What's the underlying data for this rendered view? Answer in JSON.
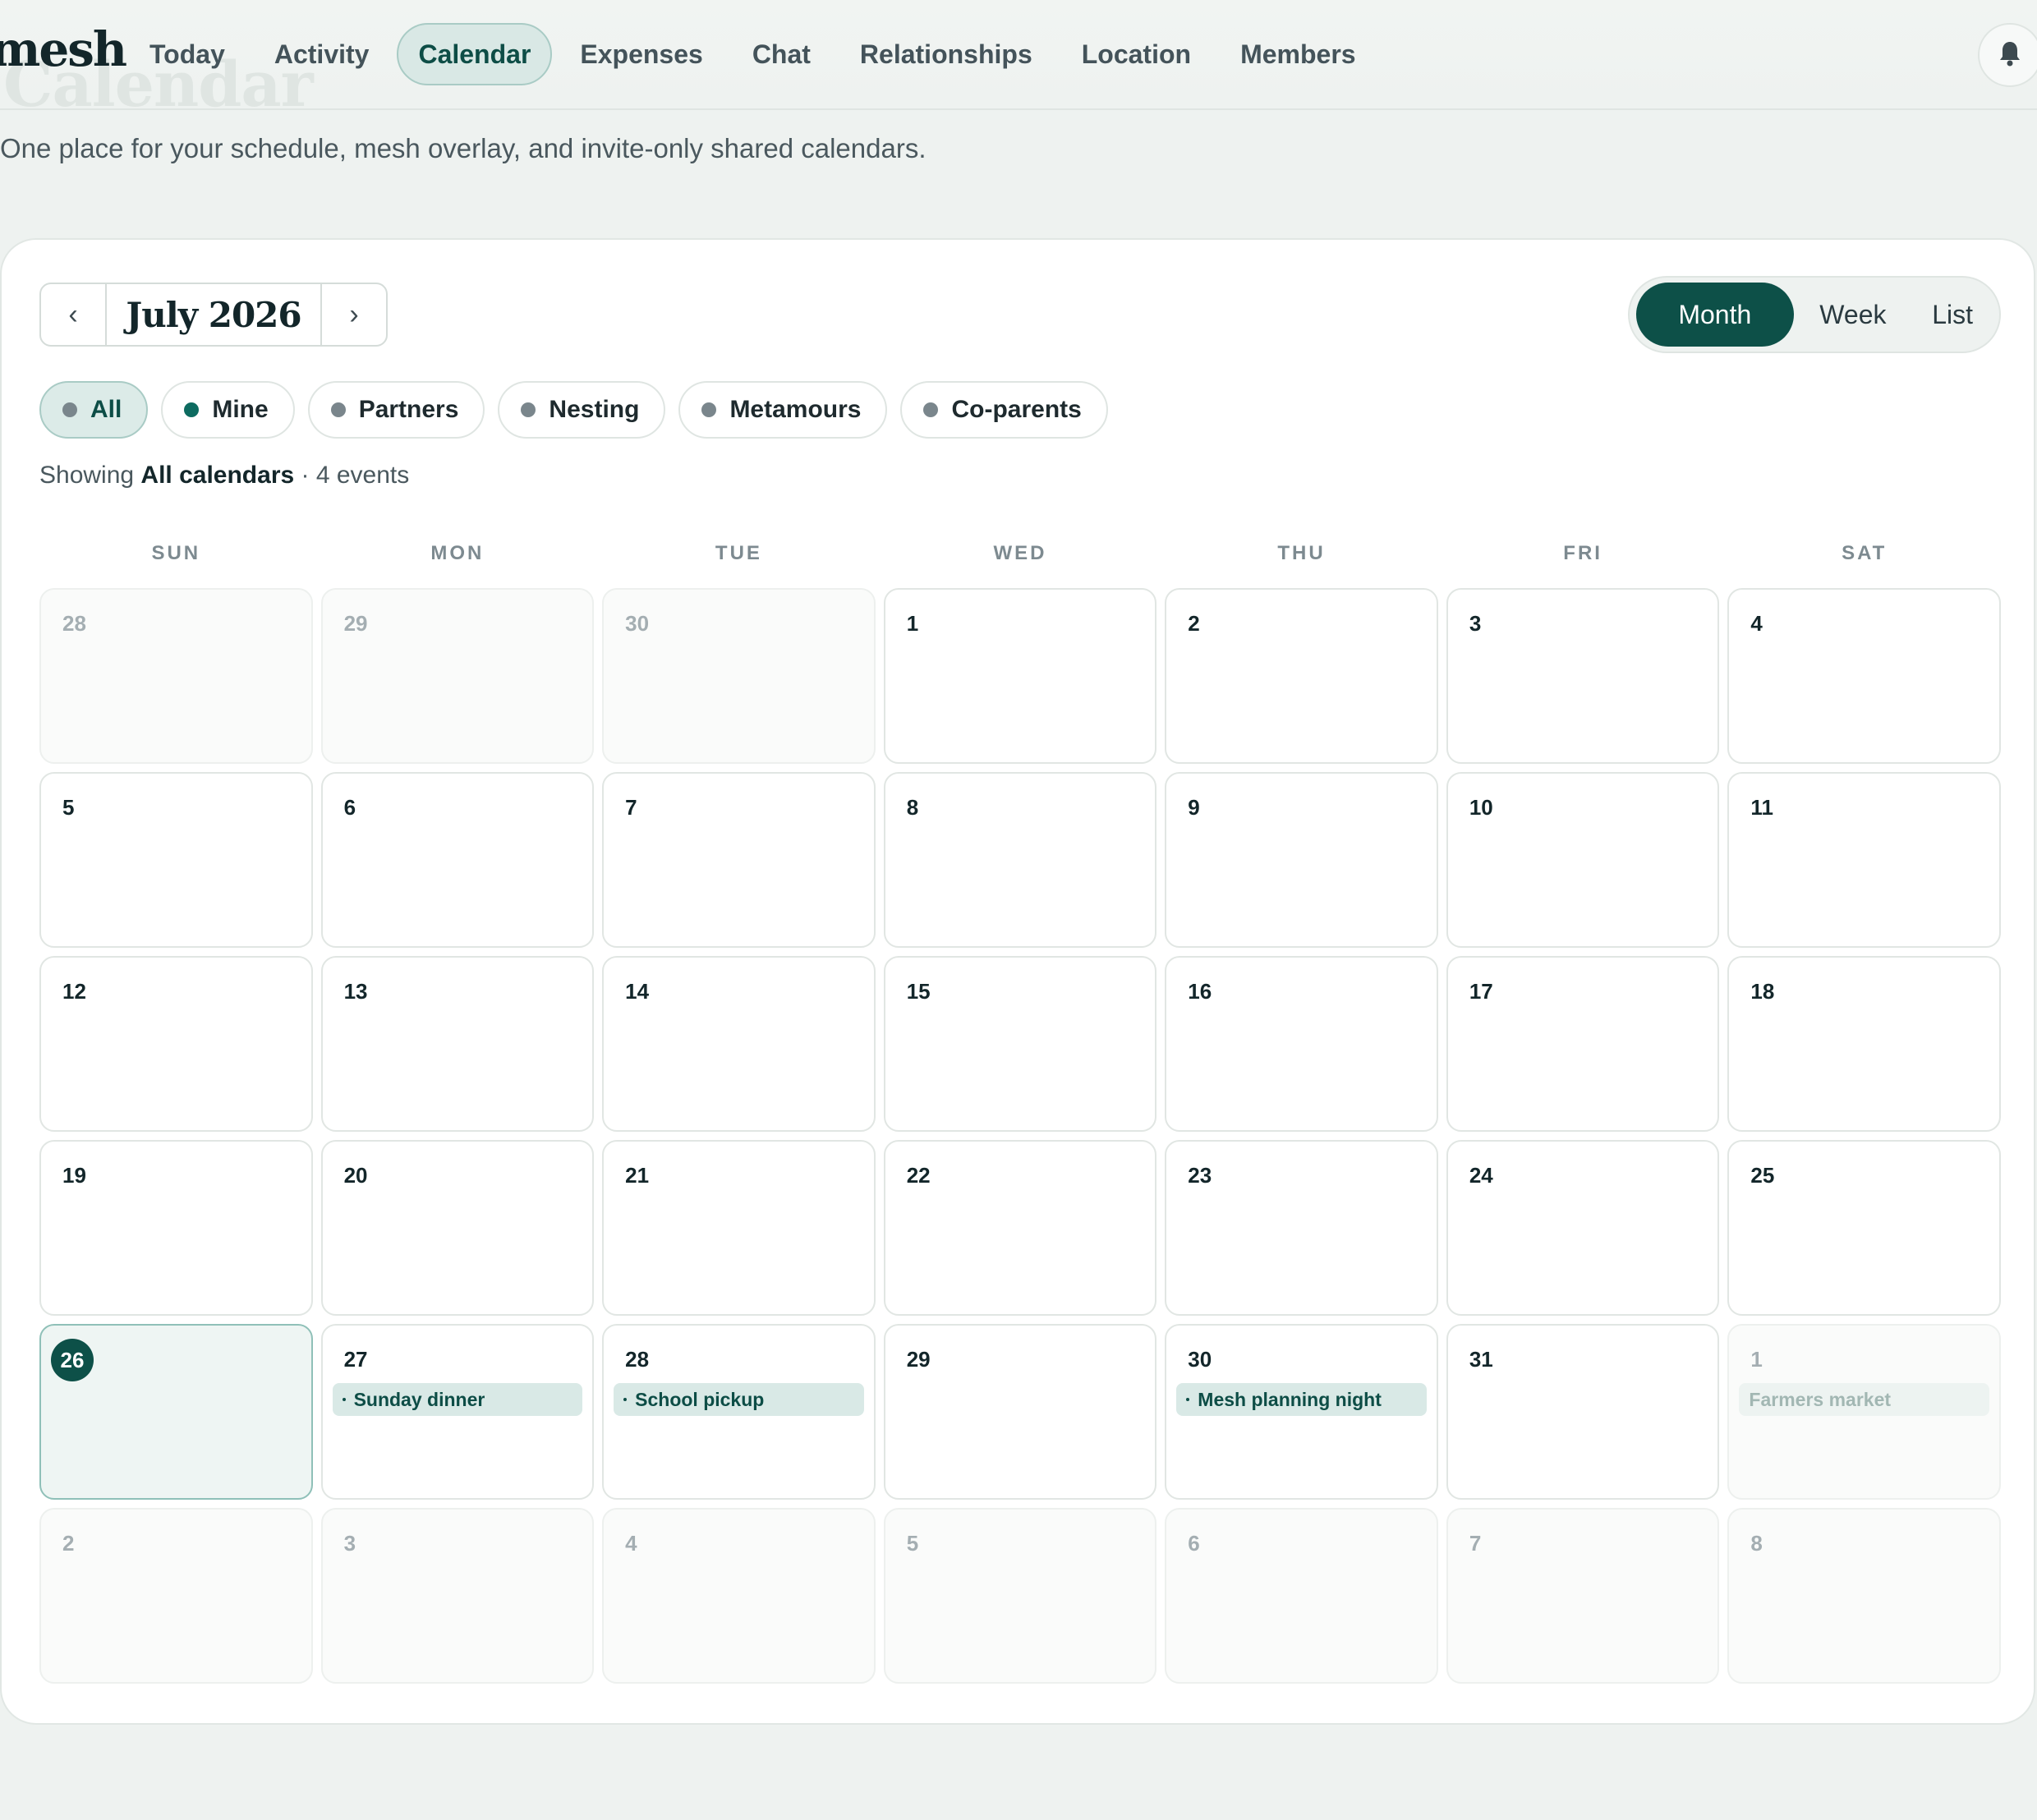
{
  "nav": {
    "brand": "mesh",
    "ghost_title": "Calendar",
    "items": [
      {
        "label": "Today",
        "active": false
      },
      {
        "label": "Activity",
        "active": false
      },
      {
        "label": "Calendar",
        "active": true
      },
      {
        "label": "Expenses",
        "active": false
      },
      {
        "label": "Chat",
        "active": false
      },
      {
        "label": "Relationships",
        "active": false
      },
      {
        "label": "Location",
        "active": false
      },
      {
        "label": "Members",
        "active": false
      }
    ],
    "notifications_icon": "bell-icon"
  },
  "page": {
    "subtitle": "One place for your schedule, mesh overlay, and invite-only shared calendars."
  },
  "calendar": {
    "prev_label": "‹",
    "next_label": "›",
    "month_label": "July 2026",
    "views": [
      {
        "label": "Month",
        "active": true
      },
      {
        "label": "Week",
        "active": false
      },
      {
        "label": "List",
        "active": false
      }
    ],
    "filters": [
      {
        "label": "All",
        "active": true,
        "color": "#7a868c"
      },
      {
        "label": "Mine",
        "active": false,
        "color": "#0d6b60"
      },
      {
        "label": "Partners",
        "active": false,
        "color": "#7a868c"
      },
      {
        "label": "Nesting",
        "active": false,
        "color": "#7a868c"
      },
      {
        "label": "Metamours",
        "active": false,
        "color": "#7a868c"
      },
      {
        "label": "Co-parents",
        "active": false,
        "color": "#7a868c"
      }
    ],
    "showing_prefix": "Showing",
    "showing_bold": "All calendars",
    "showing_suffix": "· 4 events",
    "weekdays": [
      "SUN",
      "MON",
      "TUE",
      "WED",
      "THU",
      "FRI",
      "SAT"
    ],
    "today": 26,
    "weeks": [
      [
        {
          "d": "28",
          "out": true
        },
        {
          "d": "29",
          "out": true
        },
        {
          "d": "30",
          "out": true
        },
        {
          "d": "1"
        },
        {
          "d": "2"
        },
        {
          "d": "3"
        },
        {
          "d": "4"
        }
      ],
      [
        {
          "d": "5"
        },
        {
          "d": "6"
        },
        {
          "d": "7"
        },
        {
          "d": "8"
        },
        {
          "d": "9"
        },
        {
          "d": "10"
        },
        {
          "d": "11"
        }
      ],
      [
        {
          "d": "12"
        },
        {
          "d": "13"
        },
        {
          "d": "14"
        },
        {
          "d": "15"
        },
        {
          "d": "16"
        },
        {
          "d": "17"
        },
        {
          "d": "18"
        }
      ],
      [
        {
          "d": "19"
        },
        {
          "d": "20"
        },
        {
          "d": "21"
        },
        {
          "d": "22"
        },
        {
          "d": "23"
        },
        {
          "d": "24"
        },
        {
          "d": "25"
        }
      ],
      [
        {
          "d": "26",
          "today": true
        },
        {
          "d": "27",
          "event": "Sunday dinner"
        },
        {
          "d": "28",
          "event": "School pickup"
        },
        {
          "d": "29"
        },
        {
          "d": "30",
          "event": "Mesh planning night"
        },
        {
          "d": "31"
        },
        {
          "d": "1",
          "out": true,
          "event": "Farmers market"
        }
      ],
      [
        {
          "d": "2",
          "out": true
        },
        {
          "d": "3",
          "out": true
        },
        {
          "d": "4",
          "out": true
        },
        {
          "d": "5",
          "out": true
        },
        {
          "d": "6",
          "out": true
        },
        {
          "d": "7",
          "out": true
        },
        {
          "d": "8",
          "out": true
        }
      ]
    ],
    "colors": {
      "accent": "#0d5048",
      "accent_soft": "#d9e9e6",
      "card_bg": "#ffffff",
      "page_bg": "#eef2f0"
    }
  }
}
